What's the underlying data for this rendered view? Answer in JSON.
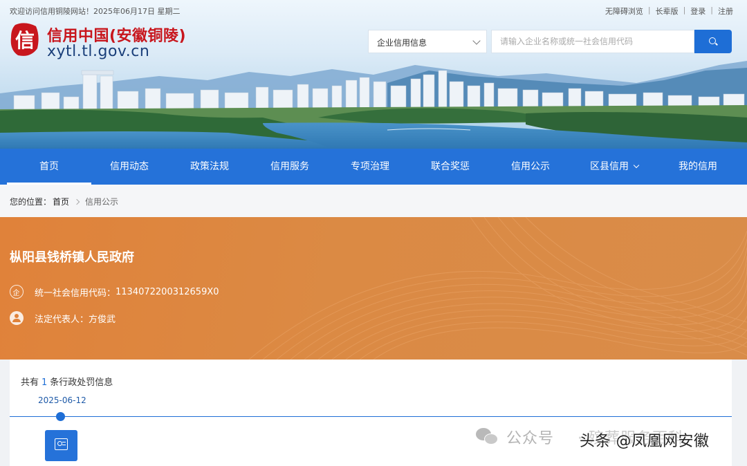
{
  "topbar": {
    "welcome": "欢迎访问信用铜陵网站！",
    "date": "2025年06月17日 星期二",
    "links": [
      "无障碍浏览",
      "长辈版",
      "登录",
      "注册"
    ]
  },
  "logo": {
    "seal_char": "信",
    "title": "信用中国(安徽铜陵)",
    "url": "xytl.tl.gov.cn"
  },
  "search": {
    "category": "企业信用信息",
    "placeholder": "请输入企业名称或统一社会信用代码",
    "button_icon": "search-icon"
  },
  "nav": {
    "items": [
      {
        "label": "首页",
        "active": true
      },
      {
        "label": "信用动态"
      },
      {
        "label": "政策法规"
      },
      {
        "label": "信用服务"
      },
      {
        "label": "专项治理"
      },
      {
        "label": "联合奖惩"
      },
      {
        "label": "信用公示"
      },
      {
        "label": "区县信用",
        "dropdown": true
      },
      {
        "label": "我的信用"
      }
    ]
  },
  "breadcrumb": {
    "prefix": "您的位置：",
    "home": "首页",
    "current": "信用公示"
  },
  "entity": {
    "name": "枞阳县钱桥镇人民政府",
    "credit_code_label": "统一社会信用代码：",
    "credit_code": "1134072200312659X0",
    "legal_rep_label": "法定代表人：",
    "legal_rep": "方俊武",
    "credit_icon_text": "企",
    "credit_icon": "enterprise-icon",
    "legal_rep_icon": "person-icon"
  },
  "records": {
    "prefix": "共有",
    "count": "1",
    "suffix": "条行政处罚信息",
    "items": [
      {
        "date": "2025-06-12",
        "icon": "document-icon"
      }
    ]
  },
  "watermark": {
    "wechat_label": "公众号",
    "account": "· 殡葬服务百科",
    "platform": "头条 @凤凰网安徽"
  },
  "colors": {
    "primary_blue": "#2572d9",
    "accent_orange": "#e0823a",
    "logo_red": "#c8161d",
    "logo_navy": "#1a3f7a"
  }
}
